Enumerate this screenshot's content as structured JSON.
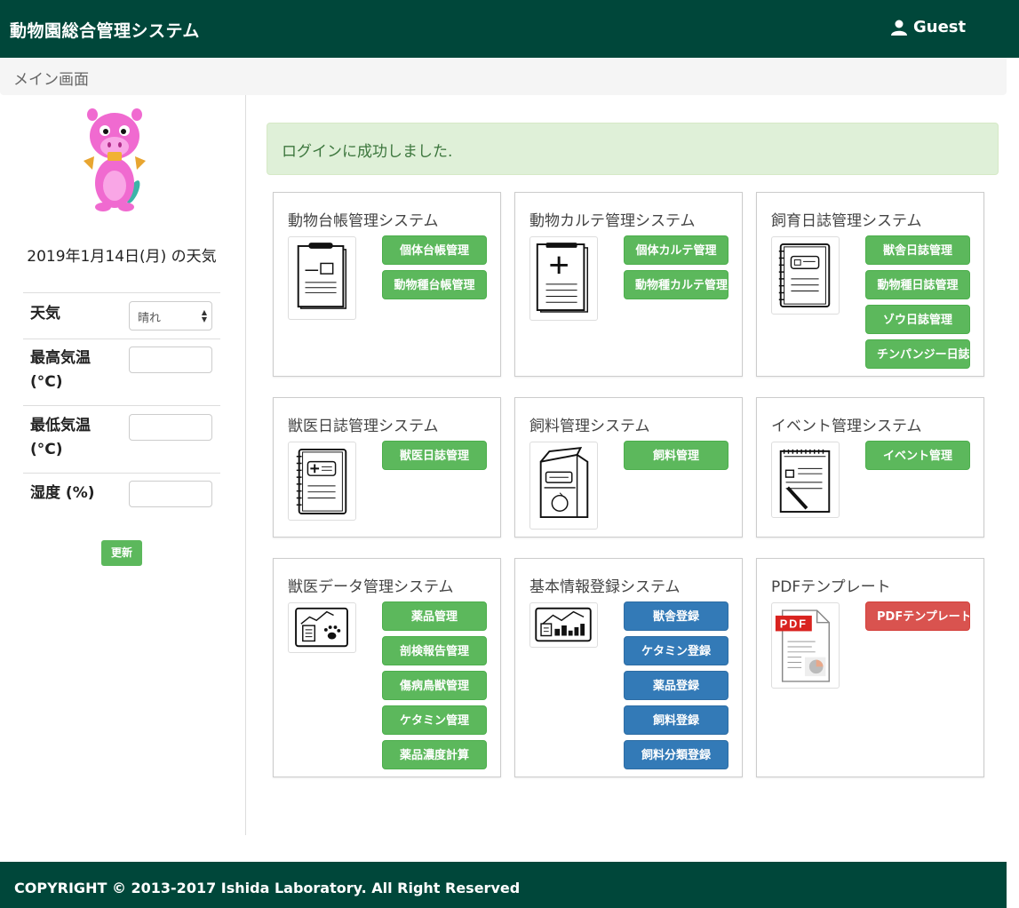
{
  "navbar": {
    "brand": "動物園総合管理システム",
    "user": "Guest",
    "user_icon": "user-icon"
  },
  "breadcrumb": {
    "current": "メイン画面"
  },
  "sidebar": {
    "weather_date": "2019年1月14日(月) の天気",
    "weather_label": "天気",
    "weather_value": "晴れ",
    "max_temp_label": "最高気温 (°C)",
    "min_temp_label": "最低気温 (°C)",
    "humidity_label": "湿度 (%)",
    "update_button": "更新"
  },
  "alert": {
    "message": "ログインに成功しました."
  },
  "cards": [
    {
      "title": "動物台帳管理システム",
      "icon": "clipboard-icon",
      "buttons": [
        "個体台帳管理",
        "動物種台帳管理"
      ]
    },
    {
      "title": "動物カルテ管理システム",
      "icon": "medical-chart-icon",
      "buttons": [
        "個体カルテ管理",
        "動物種カルテ管理"
      ]
    },
    {
      "title": "飼育日誌管理システム",
      "icon": "notebook-icon",
      "buttons": [
        "獣舎日誌管理",
        "動物種日誌管理",
        "ゾウ日誌管理",
        "チンパンジー日誌管理"
      ]
    },
    {
      "title": "獣医日誌管理システム",
      "icon": "vet-notebook-icon",
      "buttons": [
        "獣医日誌管理"
      ]
    },
    {
      "title": "飼料管理システム",
      "icon": "feed-box-icon",
      "buttons": [
        "飼料管理"
      ]
    },
    {
      "title": "イベント管理システム",
      "icon": "event-note-icon",
      "buttons": [
        "イベント管理"
      ]
    },
    {
      "title": "獣医データ管理システム",
      "icon": "vet-data-icon",
      "buttons": [
        "薬品管理",
        "剖検報告管理",
        "傷病鳥獣管理",
        "ケタミン管理",
        "薬品濃度計算"
      ]
    },
    {
      "title": "基本情報登録システム",
      "icon": "chart-board-icon",
      "buttons": [
        "獣舎登録",
        "ケタミン登録",
        "薬品登録",
        "飼料登録",
        "飼料分類登録"
      ]
    },
    {
      "title": "PDFテンプレート",
      "icon": "pdf-icon",
      "buttons": [
        "PDFテンプレート"
      ]
    }
  ],
  "colors": {
    "header": "#00473a",
    "green_button": "#5cb85c",
    "blue_button": "#337ab7",
    "red_button": "#d9534f",
    "alert_bg": "#dff0d8"
  },
  "footer": {
    "copyright": "COPYRIGHT © 2013-2017 Ishida Laboratory. All Right Reserved"
  }
}
